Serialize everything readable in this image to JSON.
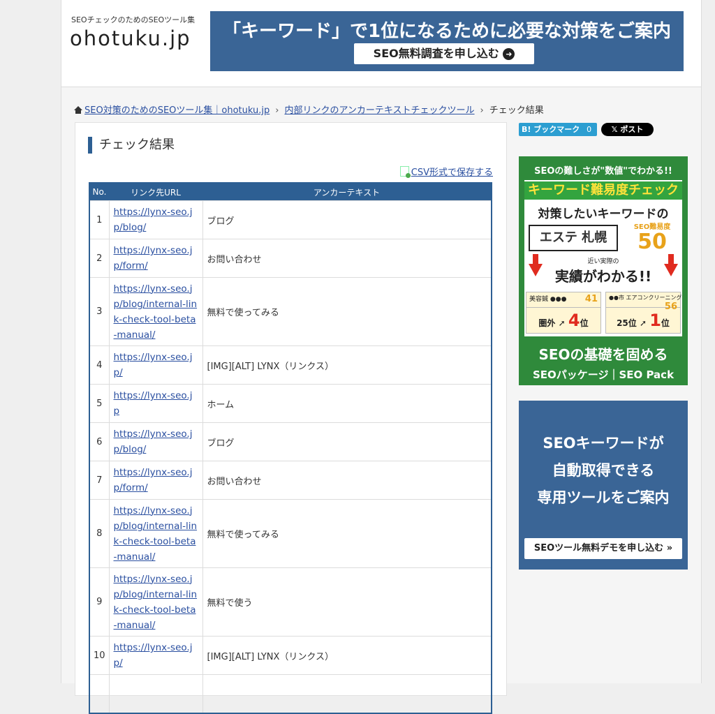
{
  "header": {
    "tagline": "SEOチェックのためのSEOツール集",
    "logo": "ohotuku.jp",
    "banner_title": "「キーワード」で1位になるために必要な対策をご案内",
    "banner_button": "SEO無料調査を申し込む",
    "banner_button_icon": "arrow-right-circle-icon"
  },
  "breadcrumb": {
    "home": "SEO対策のためのSEOツール集｜ohotuku.jp",
    "parent": "内部リンクのアンカーテキストチェックツール",
    "current": "チェック結果",
    "separator": "›"
  },
  "main": {
    "title": "チェック結果",
    "csv_link": "CSV形式で保存する"
  },
  "table": {
    "headers": [
      "No.",
      "リンク先URL",
      "アンカーテキスト"
    ],
    "rows": [
      {
        "no": "1",
        "url": "https://lynx-seo.jp/blog/",
        "anchor": "ブログ"
      },
      {
        "no": "2",
        "url": "https://lynx-seo.jp/form/",
        "anchor": "お問い合わせ"
      },
      {
        "no": "3",
        "url": "https://lynx-seo.jp/blog/internal-link-check-tool-beta-manual/",
        "anchor": "無料で使ってみる"
      },
      {
        "no": "4",
        "url": "https://lynx-seo.jp/",
        "anchor": "[IMG][ALT] LYNX（リンクス）"
      },
      {
        "no": "5",
        "url": "https://lynx-seo.jp",
        "anchor": "ホーム"
      },
      {
        "no": "6",
        "url": "https://lynx-seo.jp/blog/",
        "anchor": "ブログ"
      },
      {
        "no": "7",
        "url": "https://lynx-seo.jp/form/",
        "anchor": "お問い合わせ"
      },
      {
        "no": "8",
        "url": "https://lynx-seo.jp/blog/internal-link-check-tool-beta-manual/",
        "anchor": "無料で使ってみる"
      },
      {
        "no": "9",
        "url": "https://lynx-seo.jp/blog/internal-link-check-tool-beta-manual/",
        "anchor": "無料で使う"
      },
      {
        "no": "10",
        "url": "https://lynx-seo.jp/",
        "anchor": "[IMG][ALT] LYNX（リンクス）"
      }
    ]
  },
  "share": {
    "hatena": "B! ブックマーク",
    "hatena_count": "0",
    "post": "ポスト",
    "post_icon": "x-logo-icon"
  },
  "ad1": {
    "top": "SEOの難しさが\"数値\"でわかる!!",
    "title": "キーワード難易度チェック",
    "sub": "対策したいキーワードの",
    "keyword": "エステ 札幌",
    "diff_label": "SEO難易度",
    "diff_value": "50",
    "mid_small": "近い実際の",
    "mid": "実績がわかる!!",
    "cell1_label": "美容鍼 ●●●",
    "cell1_value": "41",
    "cell1_from": "圏外",
    "cell1_to": "4",
    "cell2_label": "●●市 エアコンクリーニング",
    "cell2_value": "56",
    "cell2_from": "25位",
    "cell2_to": "1",
    "rank_unit": "位",
    "bottom1": "SEOの基礎を固める",
    "bottom2": "SEOパッケージ｜SEO Pack"
  },
  "ad2": {
    "line1": "SEOキーワードが",
    "line2": "自動取得できる",
    "line3": "専用ツールをご案内",
    "button": "SEOツール無料デモを申し込む »"
  },
  "colors": {
    "primary": "#2d5f93",
    "banner": "#3a6596",
    "link": "#2a4fa0",
    "ad_green": "#2f8a3b",
    "accent_red": "#e02b1f"
  }
}
